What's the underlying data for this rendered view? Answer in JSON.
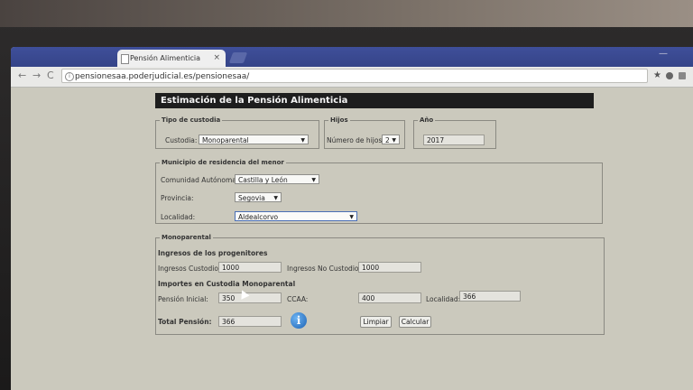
{
  "browser": {
    "tab_title": "Pensión Alimenticia",
    "tab_close": "×",
    "url": "pensionesaa.poderjudicial.es/pensionesaa/",
    "back_glyph": "←",
    "forward_glyph": "→",
    "reload_glyph": "C",
    "star_glyph": "★",
    "min_glyph": "—"
  },
  "form": {
    "title": "Estimación de la Pensión Alimenticia",
    "tipo_custodia": {
      "legend": "Tipo de custodia",
      "label": "Custodia:",
      "value": "Monoparental"
    },
    "hijos": {
      "legend": "Hijos",
      "label": "Número de hijos:",
      "value": "2"
    },
    "anio": {
      "legend": "Año",
      "value": "2017"
    },
    "municipio": {
      "legend": "Municipio de residencia del menor",
      "comunidad_label": "Comunidad Autónoma:",
      "comunidad_value": "Castilla y León",
      "provincia_label": "Provincia:",
      "provincia_value": "Segovia",
      "localidad_label": "Localidad:",
      "localidad_value": "Aldealcorvo"
    },
    "monoparental": {
      "legend": "Monoparental",
      "ingresos_title": "Ingresos de los progenitores",
      "ingresos_custodio_label": "Ingresos Custodio:",
      "ingresos_custodio_value": "1000",
      "ingresos_no_custodio_label": "Ingresos No Custodio:",
      "ingresos_no_custodio_value": "1000",
      "importes_title": "Importes en Custodia Monoparental",
      "pension_inicial_label": "Pensión Inicial:",
      "pension_inicial_value": "350",
      "ccaa_label": "CCAA:",
      "ccaa_value": "400",
      "localidad_label": "Localidad:",
      "localidad_value": "366",
      "total_label": "Total Pensión:",
      "total_value": "366",
      "info_glyph": "i",
      "limpiar_label": "Limpiar",
      "calcular_label": "Calcular"
    }
  },
  "colors": {
    "tabbar": "#3f4f9a",
    "header_bg": "#1e1e1e",
    "page_bg": "#cbc9bd",
    "info_blue": "#1c62b4"
  }
}
